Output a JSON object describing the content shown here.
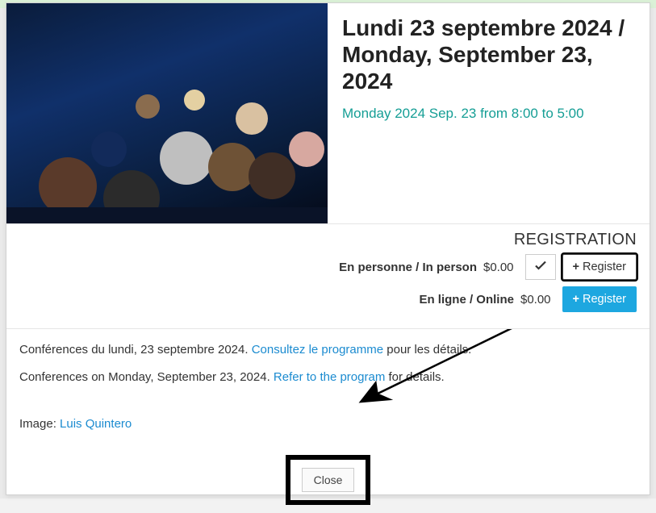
{
  "header": {
    "title": "Lundi 23 septembre 2024 / Monday, September 23, 2024",
    "datetime": "Monday 2024 Sep. 23 from 8:00 to 5:00"
  },
  "registration": {
    "heading": "REGISTRATION",
    "options": [
      {
        "label": "En personne / In person",
        "price": "$0.00",
        "selected": true,
        "button_label": "Register",
        "button_style": "outline"
      },
      {
        "label": "En ligne / Online",
        "price": "$0.00",
        "selected": false,
        "button_label": "Register",
        "button_style": "primary"
      }
    ]
  },
  "description": {
    "line1_prefix": "Conférences du lundi, 23 septembre 2024. ",
    "line1_link": "Consultez le programme",
    "line1_suffix": " pour les détails.",
    "line2_prefix": "Conferences on Monday, September 23, 2024. ",
    "line2_link": "Refer to the program",
    "line2_suffix": " for details.",
    "image_label": "Image: ",
    "image_credit": "Luis Quintero"
  },
  "footer": {
    "close_label": "Close"
  }
}
